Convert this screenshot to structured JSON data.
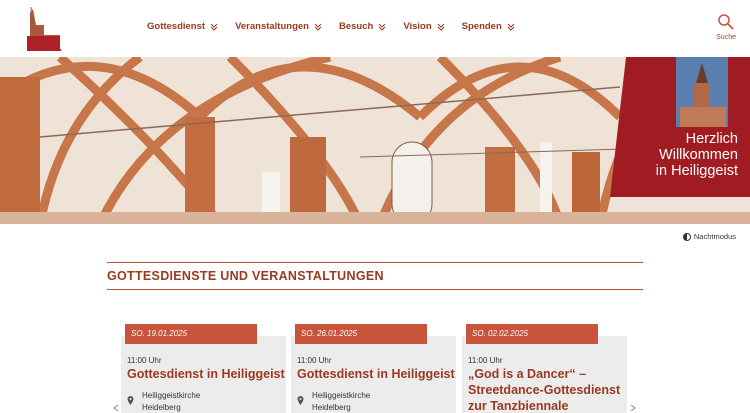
{
  "header": {
    "nav": [
      {
        "label": "Gottesdienst"
      },
      {
        "label": "Veranstaltungen"
      },
      {
        "label": "Besuch"
      },
      {
        "label": "Vision"
      },
      {
        "label": "Spenden"
      }
    ],
    "search_label": "Suche"
  },
  "hero": {
    "welcome_line1": "Herzlich",
    "welcome_line2": "Willkommen",
    "welcome_line3": "in Heiliggeist"
  },
  "nightmode": {
    "label": "Nachtmodus"
  },
  "section": {
    "title": "GOTTESDIENSTE UND VERANSTALTUNGEN"
  },
  "events": [
    {
      "date": "SO. 19.01.2025",
      "time": "11:00 Uhr",
      "title": "Gottesdienst in Heiliggeist",
      "place1": "Heiliggeistkirche",
      "place2": "Heidelberg"
    },
    {
      "date": "SO. 26.01.2025",
      "time": "11:00 Uhr",
      "title": "Gottesdienst in Heiliggeist",
      "place1": "Heiliggeistkirche",
      "place2": "Heidelberg"
    },
    {
      "date": "SO. 02.02.2025",
      "time": "11:00 Uhr",
      "title": "„God is a Dancer“ – Streetdance-Gottesdienst zur Tanzbiennale",
      "place1": "",
      "place2": ""
    }
  ],
  "colors": {
    "brand": "#9a3a1f",
    "accent": "#c9543c",
    "banner": "#a01c22"
  }
}
